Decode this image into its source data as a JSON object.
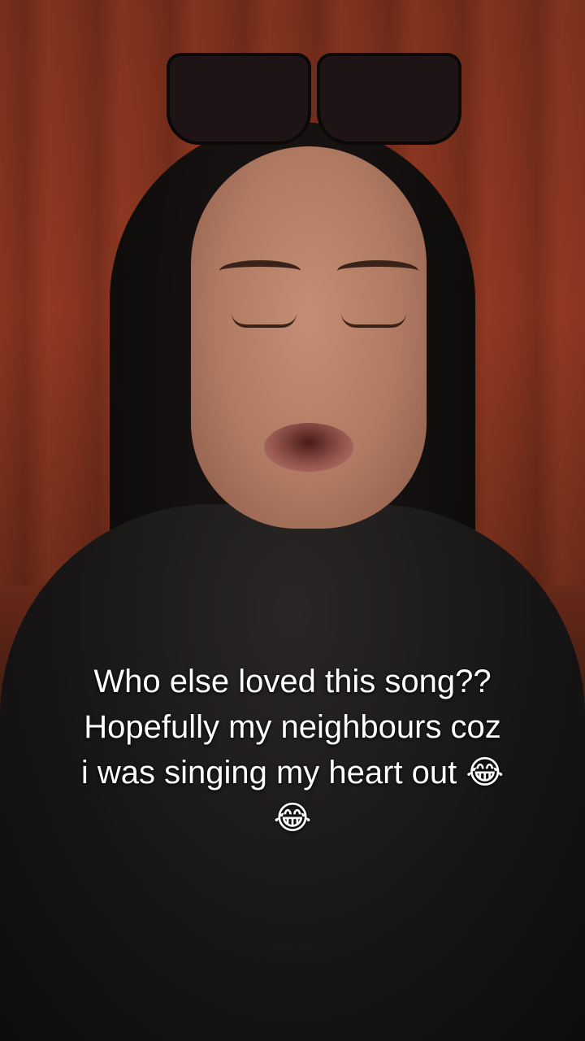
{
  "caption": {
    "line1": "Who else loved this song??",
    "line2": "Hopefully my neighbours coz",
    "line3": "i was singing my heart out 😂",
    "line4": "😂"
  }
}
